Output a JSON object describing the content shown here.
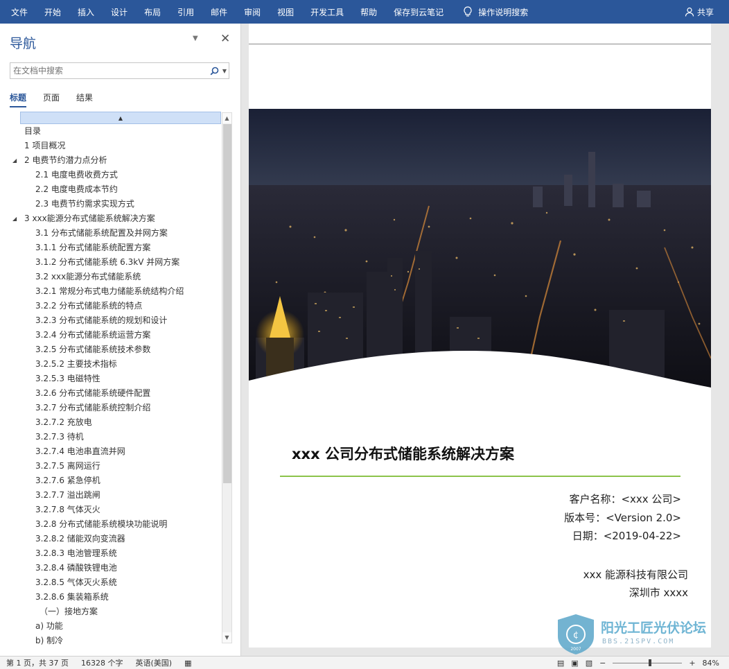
{
  "ribbon": {
    "tabs": [
      "文件",
      "开始",
      "插入",
      "设计",
      "布局",
      "引用",
      "邮件",
      "审阅",
      "视图",
      "开发工具",
      "帮助",
      "保存到云笔记"
    ],
    "tell_me": "操作说明搜索",
    "share": "共享",
    "bg_color": "#2b579a"
  },
  "nav": {
    "title": "导航",
    "search_placeholder": "在文档中搜索",
    "tabs": [
      "标题",
      "页面",
      "结果"
    ],
    "active_tab": "标题",
    "outline": [
      {
        "text": "目录",
        "level": 1,
        "toggle": false
      },
      {
        "text": "1  项目概况",
        "level": 1,
        "toggle": false
      },
      {
        "text": "2  电费节约潜力点分析",
        "level": 1,
        "toggle": true
      },
      {
        "text": "2.1 电度电费收费方式",
        "level": 2,
        "toggle": false
      },
      {
        "text": "2.2 电度电费成本节约",
        "level": 2,
        "toggle": false
      },
      {
        "text": "2.3 电费节约需求实现方式",
        "level": 2,
        "toggle": false
      },
      {
        "text": "3  xxx能源分布式储能系统解决方案",
        "level": 1,
        "toggle": true
      },
      {
        "text": "3.1 分布式储能系统配置及并网方案",
        "level": 2,
        "toggle": false
      },
      {
        "text": "3.1.1 分布式储能系统配置方案",
        "level": 2,
        "toggle": false
      },
      {
        "text": "3.1.2  分布式储能系统 6.3kV 并网方案",
        "level": 2,
        "toggle": false
      },
      {
        "text": "3.2 xxx能源分布式储能系统",
        "level": 2,
        "toggle": false
      },
      {
        "text": "3.2.1 常规分布式电力储能系统结构介绍",
        "level": 2,
        "toggle": false
      },
      {
        "text": "3.2.2 分布式储能系统的特点",
        "level": 2,
        "toggle": false
      },
      {
        "text": "3.2.3 分布式储能系统的规划和设计",
        "level": 2,
        "toggle": false
      },
      {
        "text": "3.2.4 分布式储能系统运营方案",
        "level": 2,
        "toggle": false
      },
      {
        "text": "3.2.5 分布式储能系统技术参数",
        "level": 2,
        "toggle": false
      },
      {
        "text": "3.2.5.2  主要技术指标",
        "level": 2,
        "toggle": false
      },
      {
        "text": "3.2.5.3  电磁特性",
        "level": 2,
        "toggle": false
      },
      {
        "text": "3.2.6 分布式储能系统硬件配置",
        "level": 2,
        "toggle": false
      },
      {
        "text": "3.2.7 分布式储能系统控制介绍",
        "level": 2,
        "toggle": false
      },
      {
        "text": "3.2.7.2  充放电",
        "level": 2,
        "toggle": false
      },
      {
        "text": "3.2.7.3  待机",
        "level": 2,
        "toggle": false
      },
      {
        "text": "3.2.7.4  电池串直流并网",
        "level": 2,
        "toggle": false
      },
      {
        "text": "3.2.7.5  离网运行",
        "level": 2,
        "toggle": false
      },
      {
        "text": "3.2.7.6  紧急停机",
        "level": 2,
        "toggle": false
      },
      {
        "text": "3.2.7.7  溢出跳闸",
        "level": 2,
        "toggle": false
      },
      {
        "text": "3.2.7.8  气体灭火",
        "level": 2,
        "toggle": false
      },
      {
        "text": "3.2.8 分布式储能系统模块功能说明",
        "level": 2,
        "toggle": false
      },
      {
        "text": "3.2.8.2  储能双向变流器",
        "level": 2,
        "toggle": false
      },
      {
        "text": "3.2.8.3  电池管理系统",
        "level": 2,
        "toggle": false
      },
      {
        "text": "3.2.8.4  磷酸铁锂电池",
        "level": 2,
        "toggle": false
      },
      {
        "text": "3.2.8.5  气体灭火系统",
        "level": 2,
        "toggle": false
      },
      {
        "text": "3.2.8.6  集装箱系统",
        "level": 2,
        "toggle": false
      },
      {
        "text": "（一）接地方案",
        "level": 3,
        "toggle": false
      },
      {
        "text": "a) 功能",
        "level": 2,
        "toggle": false
      },
      {
        "text": "b) 制冷",
        "level": 2,
        "toggle": false
      }
    ]
  },
  "document": {
    "title": "xxx 公司分布式储能系统解决方案",
    "client": "客户名称：<xxx 公司>",
    "version": "版本号：<Version 2.0>",
    "date": "日期：<2019-04-22>",
    "company": "xxx 能源科技有限公司",
    "city": "深圳市 xxxx",
    "accent_color": "#8bc34a"
  },
  "watermark": {
    "brand_cn": "阳光工匠光伏论坛",
    "brand_url": "BBS.21SPV.COM",
    "year": "2007"
  },
  "status": {
    "page": "第 1 页，共 37 页",
    "words": "16328 个字",
    "language": "英语(美国)",
    "zoom": "84%"
  }
}
